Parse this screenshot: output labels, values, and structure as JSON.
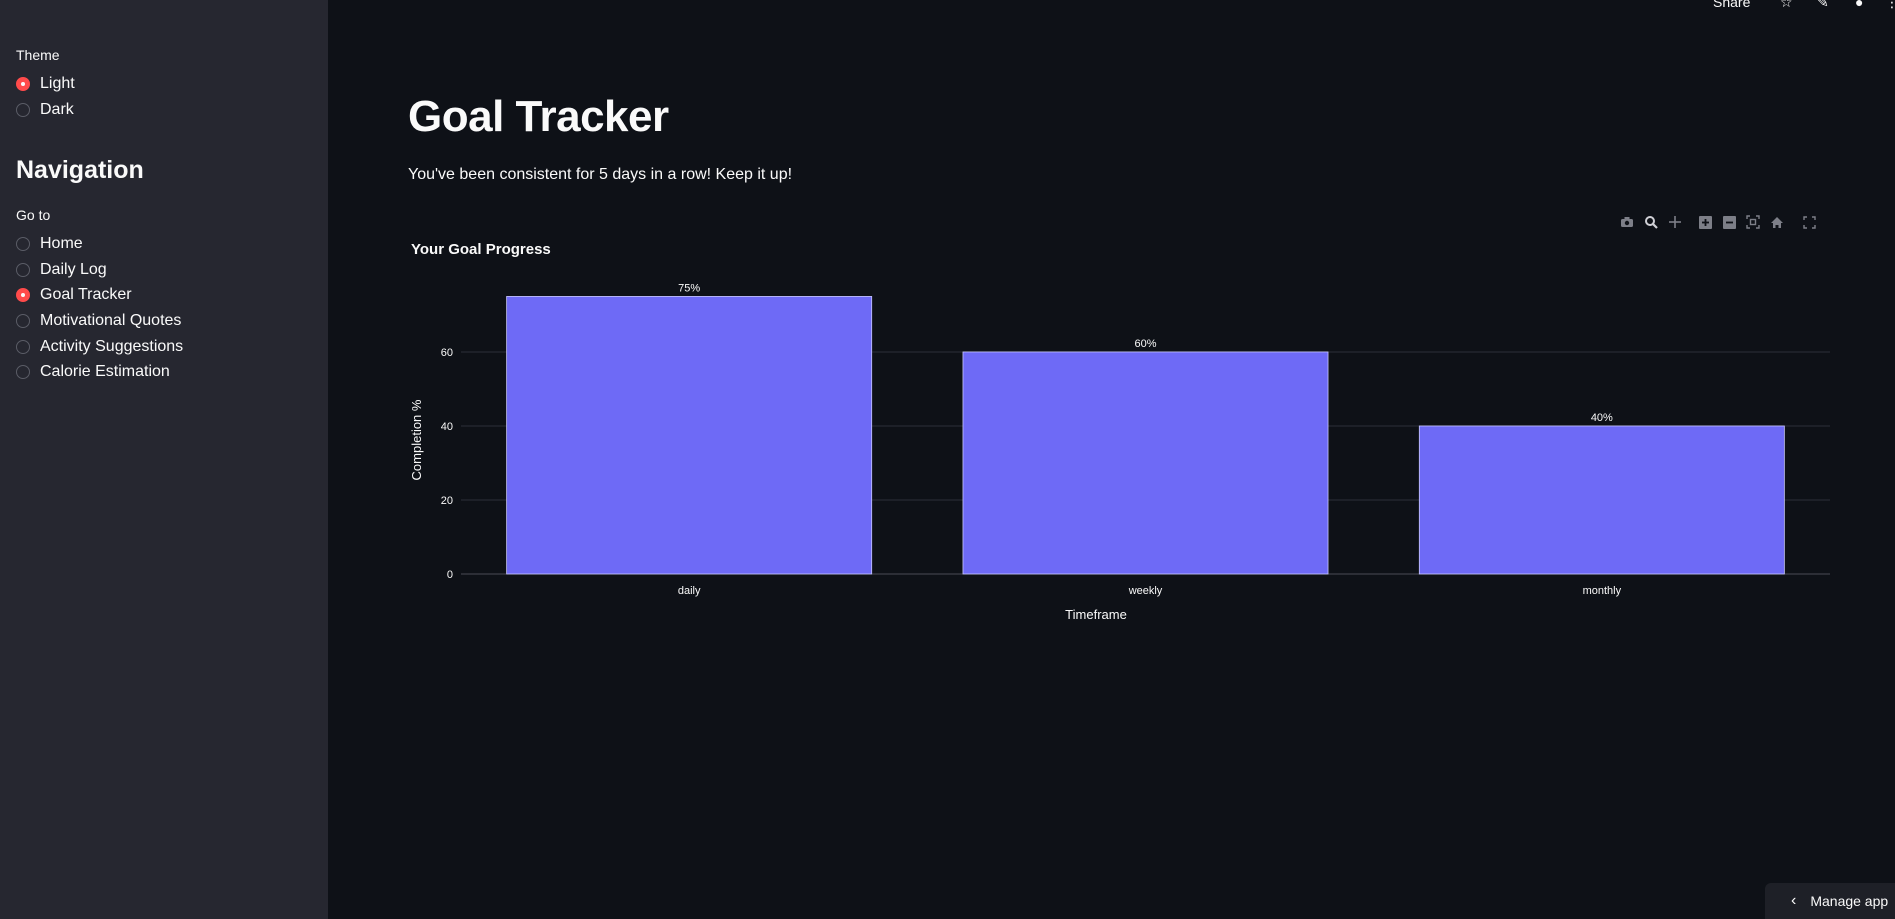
{
  "sidebar": {
    "theme_label": "Theme",
    "theme_options": [
      {
        "label": "Light",
        "selected": true
      },
      {
        "label": "Dark",
        "selected": false
      }
    ],
    "nav_heading": "Navigation",
    "goto_label": "Go to",
    "nav_options": [
      {
        "label": "Home",
        "selected": false
      },
      {
        "label": "Daily Log",
        "selected": false
      },
      {
        "label": "Goal Tracker",
        "selected": true
      },
      {
        "label": "Motivational Quotes",
        "selected": false
      },
      {
        "label": "Activity Suggestions",
        "selected": false
      },
      {
        "label": "Calorie Estimation",
        "selected": false
      }
    ]
  },
  "topbar": {
    "share_label": "Share",
    "icons": [
      "star-icon",
      "edit-icon",
      "github-icon",
      "more-icon"
    ]
  },
  "main": {
    "title": "Goal Tracker",
    "subtitle": "You've been consistent for 5 days in a row! Keep it up!"
  },
  "modebar_icons": [
    "camera-icon",
    "zoom-icon",
    "pan-icon",
    "zoom-in-icon",
    "zoom-out-icon",
    "autoscale-icon",
    "reset-axes-icon",
    "fullscreen-icon"
  ],
  "footer": {
    "manage_app_label": "Manage app"
  },
  "colors": {
    "background": "#0e1117",
    "sidebar": "#262730",
    "accent": "#ff4b4b",
    "bar": "#6e6af6"
  },
  "chart_data": {
    "type": "bar",
    "title": "Your Goal Progress",
    "xlabel": "Timeframe",
    "ylabel": "Completion %",
    "categories": [
      "daily",
      "weekly",
      "monthly"
    ],
    "values": [
      75,
      60,
      40
    ],
    "data_labels": [
      "75%",
      "60%",
      "40%"
    ],
    "yticks": [
      0,
      20,
      40,
      60
    ],
    "ylim": [
      0,
      78.9
    ],
    "grid": true
  }
}
